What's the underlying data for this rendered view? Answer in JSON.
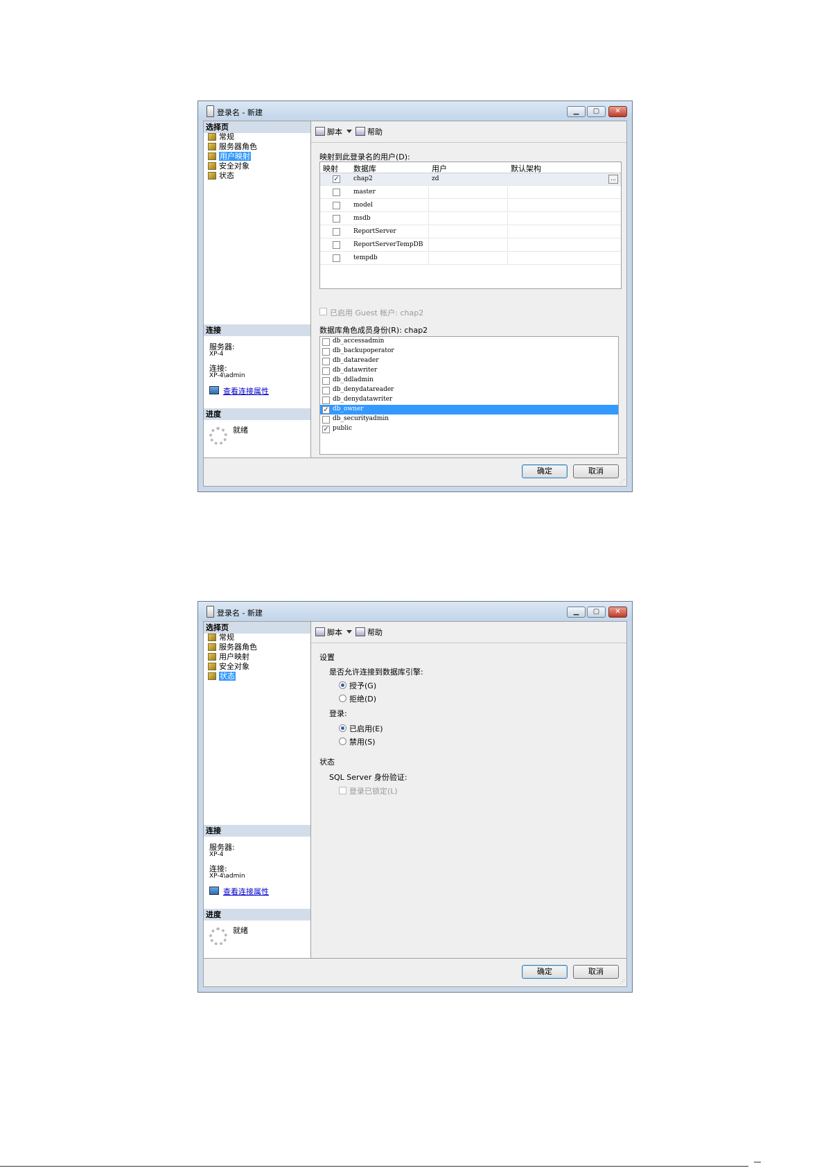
{
  "window_title": "登录名 - 新建",
  "left_pane": {
    "select_page": "选择页",
    "pages": [
      "常规",
      "服务器角色",
      "用户映射",
      "安全对象",
      "状态"
    ],
    "connection_header": "连接",
    "server_label": "服务器:",
    "server_value": "XP-4",
    "connection_label": "连接:",
    "connection_value": "XP-4\\admin",
    "view_props_link": "查看连接属性",
    "progress_header": "进度",
    "progress_status": "就绪"
  },
  "toolbar": {
    "script_label": "脚本",
    "help_label": "帮助"
  },
  "user_mapping": {
    "selected_page": "用户映射",
    "grid_label": "映射到此登录名的用户(D):",
    "columns": [
      "映射",
      "数据库",
      "用户",
      "默认架构"
    ],
    "rows": [
      {
        "checked": true,
        "database": "chap2",
        "user": "zd",
        "schema": ""
      },
      {
        "checked": false,
        "database": "master",
        "user": "",
        "schema": ""
      },
      {
        "checked": false,
        "database": "model",
        "user": "",
        "schema": ""
      },
      {
        "checked": false,
        "database": "msdb",
        "user": "",
        "schema": ""
      },
      {
        "checked": false,
        "database": "ReportServer",
        "user": "",
        "schema": ""
      },
      {
        "checked": false,
        "database": "ReportServerTempDB",
        "user": "",
        "schema": ""
      },
      {
        "checked": false,
        "database": "tempdb",
        "user": "",
        "schema": ""
      }
    ],
    "ellipsis": "...",
    "guest_label": "已启用 Guest 帐户: chap2",
    "roles_label": "数据库角色成员身份(R): chap2",
    "roles": [
      {
        "name": "db_accessadmin",
        "checked": false,
        "selected": false
      },
      {
        "name": "db_backupoperator",
        "checked": false,
        "selected": false
      },
      {
        "name": "db_datareader",
        "checked": false,
        "selected": false
      },
      {
        "name": "db_datawriter",
        "checked": false,
        "selected": false
      },
      {
        "name": "db_ddladmin",
        "checked": false,
        "selected": false
      },
      {
        "name": "db_denydatareader",
        "checked": false,
        "selected": false
      },
      {
        "name": "db_denydatawriter",
        "checked": false,
        "selected": false
      },
      {
        "name": "db_owner",
        "checked": true,
        "selected": true
      },
      {
        "name": "db_securityadmin",
        "checked": false,
        "selected": false
      },
      {
        "name": "public",
        "checked": true,
        "selected": false
      }
    ]
  },
  "status_page": {
    "selected_page": "状态",
    "settings_header": "设置",
    "permission_question": "是否允许连接到数据库引擎:",
    "grant_label": "授予(G)",
    "deny_label": "拒绝(D)",
    "login_label": "登录:",
    "enabled_label": "已启用(E)",
    "disabled_label": "禁用(S)",
    "status_header": "状态",
    "sql_auth_label": "SQL Server 身份验证:",
    "locked_label": "登录已锁定(L)"
  },
  "buttons": {
    "ok": "确定",
    "cancel": "取消"
  }
}
